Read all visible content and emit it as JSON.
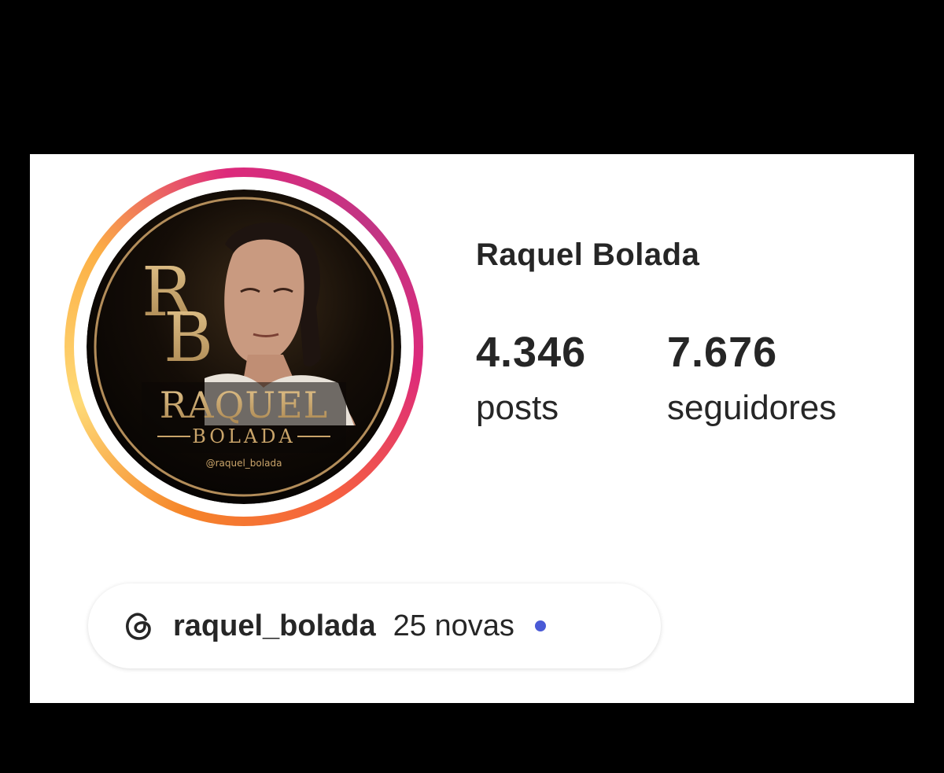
{
  "profile": {
    "name": "Raquel Bolada",
    "avatar_logo": {
      "monogram": "RB",
      "title": "RAQUEL",
      "subtitle": "BOLADA",
      "handle": "@raquel_bolada"
    }
  },
  "stats": [
    {
      "value": "4.346",
      "label": "posts"
    },
    {
      "value": "7.676",
      "label": "seguidores"
    }
  ],
  "threads_badge": {
    "icon": "threads-icon",
    "handle": "raquel_bolada",
    "count_text": "25 novas",
    "dot_color": "#4a5ad6"
  },
  "colors": {
    "background": "#000000",
    "card": "#ffffff",
    "text": "#262626",
    "avatar_gold": "#c9a46a"
  }
}
